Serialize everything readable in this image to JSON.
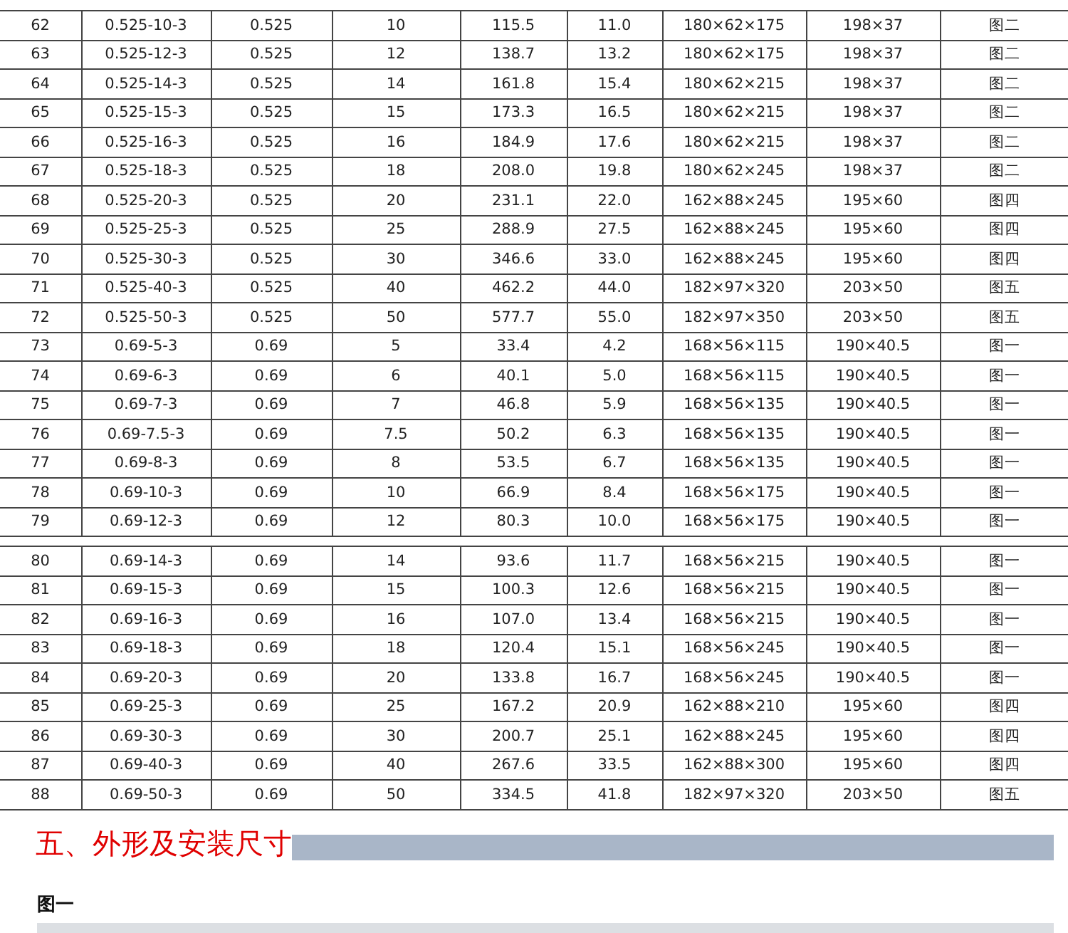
{
  "tables": [
    {
      "rows": [
        [
          "62",
          "0.525-10-3",
          "0.525",
          "10",
          "115.5",
          "11.0",
          "180×62×175",
          "198×37",
          "图二"
        ],
        [
          "63",
          "0.525-12-3",
          "0.525",
          "12",
          "138.7",
          "13.2",
          "180×62×175",
          "198×37",
          "图二"
        ],
        [
          "64",
          "0.525-14-3",
          "0.525",
          "14",
          "161.8",
          "15.4",
          "180×62×215",
          "198×37",
          "图二"
        ],
        [
          "65",
          "0.525-15-3",
          "0.525",
          "15",
          "173.3",
          "16.5",
          "180×62×215",
          "198×37",
          "图二"
        ],
        [
          "66",
          "0.525-16-3",
          "0.525",
          "16",
          "184.9",
          "17.6",
          "180×62×215",
          "198×37",
          "图二"
        ],
        [
          "67",
          "0.525-18-3",
          "0.525",
          "18",
          "208.0",
          "19.8",
          "180×62×245",
          "198×37",
          "图二"
        ],
        [
          "68",
          "0.525-20-3",
          "0.525",
          "20",
          "231.1",
          "22.0",
          "162×88×245",
          "195×60",
          "图四"
        ],
        [
          "69",
          "0.525-25-3",
          "0.525",
          "25",
          "288.9",
          "27.5",
          "162×88×245",
          "195×60",
          "图四"
        ],
        [
          "70",
          "0.525-30-3",
          "0.525",
          "30",
          "346.6",
          "33.0",
          "162×88×245",
          "195×60",
          "图四"
        ],
        [
          "71",
          "0.525-40-3",
          "0.525",
          "40",
          "462.2",
          "44.0",
          "182×97×320",
          "203×50",
          "图五"
        ],
        [
          "72",
          "0.525-50-3",
          "0.525",
          "50",
          "577.7",
          "55.0",
          "182×97×350",
          "203×50",
          "图五"
        ],
        [
          "73",
          "0.69-5-3",
          "0.69",
          "5",
          "33.4",
          "4.2",
          "168×56×115",
          "190×40.5",
          "图一"
        ],
        [
          "74",
          "0.69-6-3",
          "0.69",
          "6",
          "40.1",
          "5.0",
          "168×56×115",
          "190×40.5",
          "图一"
        ],
        [
          "75",
          "0.69-7-3",
          "0.69",
          "7",
          "46.8",
          "5.9",
          "168×56×135",
          "190×40.5",
          "图一"
        ],
        [
          "76",
          "0.69-7.5-3",
          "0.69",
          "7.5",
          "50.2",
          "6.3",
          "168×56×135",
          "190×40.5",
          "图一"
        ],
        [
          "77",
          "0.69-8-3",
          "0.69",
          "8",
          "53.5",
          "6.7",
          "168×56×135",
          "190×40.5",
          "图一"
        ],
        [
          "78",
          "0.69-10-3",
          "0.69",
          "10",
          "66.9",
          "8.4",
          "168×56×175",
          "190×40.5",
          "图一"
        ],
        [
          "79",
          "0.69-12-3",
          "0.69",
          "12",
          "80.3",
          "10.0",
          "168×56×175",
          "190×40.5",
          "图一"
        ]
      ]
    },
    {
      "rows": [
        [
          "80",
          "0.69-14-3",
          "0.69",
          "14",
          "93.6",
          "11.7",
          "168×56×215",
          "190×40.5",
          "图一"
        ],
        [
          "81",
          "0.69-15-3",
          "0.69",
          "15",
          "100.3",
          "12.6",
          "168×56×215",
          "190×40.5",
          "图一"
        ],
        [
          "82",
          "0.69-16-3",
          "0.69",
          "16",
          "107.0",
          "13.4",
          "168×56×215",
          "190×40.5",
          "图一"
        ],
        [
          "83",
          "0.69-18-3",
          "0.69",
          "18",
          "120.4",
          "15.1",
          "168×56×245",
          "190×40.5",
          "图一"
        ],
        [
          "84",
          "0.69-20-3",
          "0.69",
          "20",
          "133.8",
          "16.7",
          "168×56×245",
          "190×40.5",
          "图一"
        ],
        [
          "85",
          "0.69-25-3",
          "0.69",
          "25",
          "167.2",
          "20.9",
          "162×88×210",
          "195×60",
          "图四"
        ],
        [
          "86",
          "0.69-30-3",
          "0.69",
          "30",
          "200.7",
          "25.1",
          "162×88×245",
          "195×60",
          "图四"
        ],
        [
          "87",
          "0.69-40-3",
          "0.69",
          "40",
          "267.6",
          "33.5",
          "162×88×300",
          "195×60",
          "图四"
        ],
        [
          "88",
          "0.69-50-3",
          "0.69",
          "50",
          "334.5",
          "41.8",
          "182×97×320",
          "203×50",
          "图五"
        ]
      ]
    }
  ],
  "section_heading": "五、外形及安装尺寸",
  "figure_label": "图一"
}
